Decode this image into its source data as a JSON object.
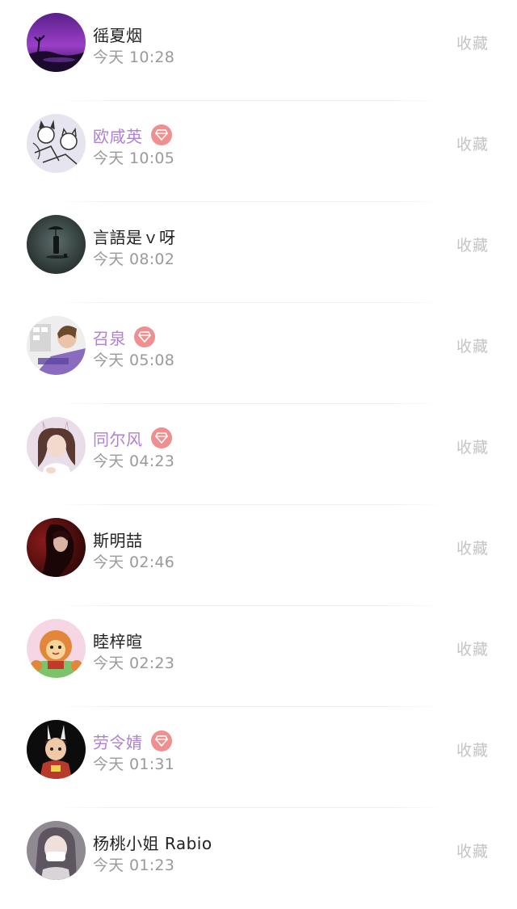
{
  "list": {
    "items": [
      {
        "name": "徭夏烟",
        "time": "今天 10:28",
        "vip": false,
        "action": "收藏",
        "avatar": "purple-night-landscape-avatar"
      },
      {
        "name": "欧咸英",
        "time": "今天 10:05",
        "vip": true,
        "action": "收藏",
        "avatar": "cartoon-cats-sketch-avatar"
      },
      {
        "name": "言語是ｖ呀",
        "time": "今天 08:02",
        "vip": false,
        "action": "收藏",
        "avatar": "umbrella-silhouette-avatar"
      },
      {
        "name": "召泉",
        "time": "今天 05:08",
        "vip": true,
        "action": "收藏",
        "avatar": "portrait-collage-avatar"
      },
      {
        "name": "同尔风",
        "time": "今天 04:23",
        "vip": true,
        "action": "收藏",
        "avatar": "bunny-ears-girl-avatar"
      },
      {
        "name": "斯明喆",
        "time": "今天 02:46",
        "vip": false,
        "action": "收藏",
        "avatar": "dark-red-portrait-avatar"
      },
      {
        "name": "睦梓暄",
        "time": "今天 02:23",
        "vip": false,
        "action": "收藏",
        "avatar": "cartoon-lion-avatar"
      },
      {
        "name": "劳令婧",
        "time": "今天 01:31",
        "vip": true,
        "action": "收藏",
        "avatar": "cartoon-opera-character-avatar"
      },
      {
        "name": "杨桃小姐 Rabio",
        "time": "今天 01:23",
        "vip": false,
        "action": "收藏",
        "avatar": "masked-girl-avatar"
      }
    ]
  },
  "colors": {
    "vip_name": "#b07fd8",
    "vip_badge": "#ef8f8f",
    "name": "#222222",
    "time": "#9a9a9a",
    "action": "#c4c4c4"
  }
}
